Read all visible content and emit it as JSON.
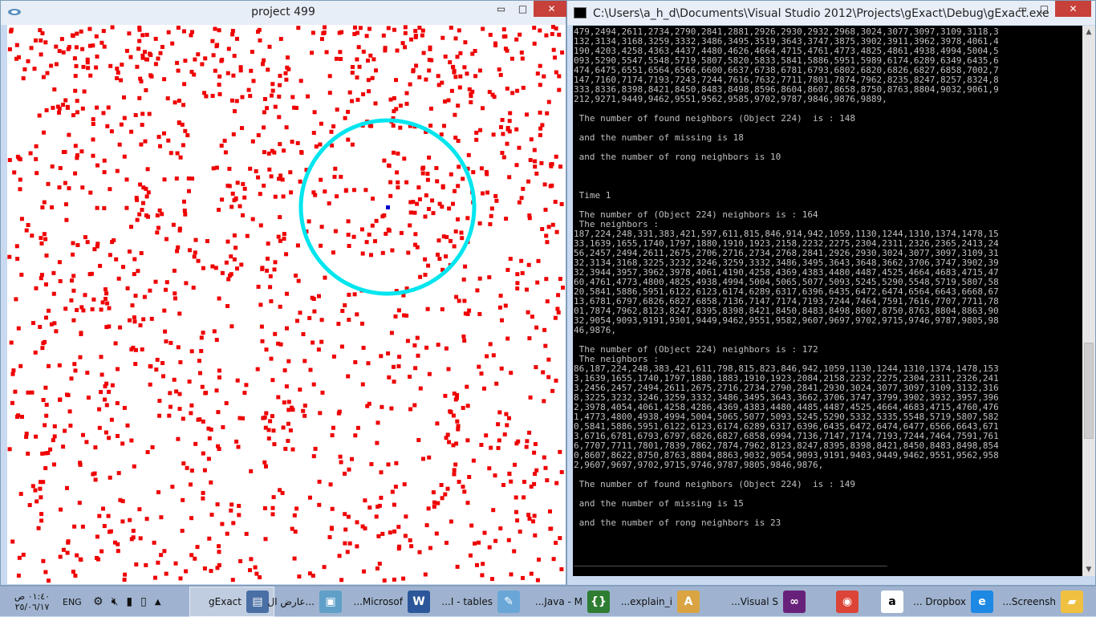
{
  "left_window": {
    "title": "project 499",
    "minimize": "▭",
    "maximize": "□",
    "close": "✕"
  },
  "right_window": {
    "title": "C:\\Users\\a_h_d\\Documents\\Visual Studio 2012\\Projects\\gExact\\Debug\\gExact.exe",
    "minimize": "▭",
    "maximize": "□",
    "close": "✕"
  },
  "console": {
    "lines": [
      "479,2494,2611,2734,2790,2841,2881,2926,2930,2932,2968,3024,3077,3097,3109,3118,3",
      "132,3134,3168,3259,3332,3486,3495,3519,3643,3747,3875,3902,3911,3962,3978,4061,4",
      "190,4203,4258,4363,4437,4480,4626,4664,4715,4761,4773,4825,4861,4938,4994,5004,5",
      "093,5290,5547,5548,5719,5807,5820,5833,5841,5886,5951,5989,6174,6289,6349,6435,6",
      "474,6475,6551,6564,6566,6600,6637,6738,6781,6793,6802,6820,6826,6827,6858,7002,7",
      "147,7160,7174,7193,7243,7244,7616,7632,7711,7801,7874,7962,8235,8247,8257,8324,8",
      "333,8336,8398,8421,8450,8483,8498,8596,8604,8607,8658,8750,8763,8804,9032,9061,9",
      "212,9271,9449,9462,9551,9562,9585,9702,9787,9846,9876,9889,",
      "",
      " The number of found neighbors (Object 224)  is : 148",
      "",
      " and the number of missing is 18",
      "",
      " and the number of rong neighbors is 10",
      "",
      "",
      "",
      " Time 1",
      "",
      " The number of (Object 224) neighbors is : 164",
      " The neighbors :",
      "187,224,248,331,383,421,597,611,815,846,914,942,1059,1130,1244,1310,1374,1478,15",
      "33,1639,1655,1740,1797,1880,1910,1923,2158,2232,2275,2304,2311,2326,2365,2413,24",
      "56,2457,2494,2611,2675,2706,2716,2734,2768,2841,2926,2930,3024,3077,3097,3109,31",
      "32,3134,3168,3225,3232,3246,3259,3332,3486,3495,3643,3648,3662,3706,3747,3902,39",
      "32,3944,3957,3962,3978,4061,4190,4258,4369,4383,4480,4487,4525,4664,4683,4715,47",
      "60,4761,4773,4800,4825,4938,4994,5004,5065,5077,5093,5245,5290,5548,5719,5807,58",
      "20,5841,5886,5951,6122,6123,6174,6289,6317,6396,6435,6472,6474,6564,6643,6668,67",
      "13,6781,6797,6826,6827,6858,7136,7147,7174,7193,7244,7464,7591,7616,7707,7711,78",
      "01,7874,7962,8123,8247,8395,8398,8421,8450,8483,8498,8607,8750,8763,8804,8863,90",
      "32,9054,9093,9191,9301,9449,9462,9551,9582,9607,9697,9702,9715,9746,9787,9805,98",
      "46,9876,",
      "",
      " The number of (Object 224) neighbors is : 172",
      " The neighbors :",
      "86,187,224,248,383,421,611,798,815,823,846,942,1059,1130,1244,1310,1374,1478,153",
      "3,1639,1655,1740,1797,1880,1883,1910,1923,2084,2158,2232,2275,2304,2311,2326,241",
      "3,2456,2457,2494,2611,2675,2716,2734,2790,2841,2930,3024,3077,3097,3109,3132,316",
      "8,3225,3232,3246,3259,3332,3486,3495,3643,3662,3706,3747,3799,3902,3932,3957,396",
      "2,3978,4054,4061,4258,4286,4369,4383,4480,4485,4487,4525,4664,4683,4715,4760,476",
      "1,4773,4800,4938,4994,5004,5065,5077,5093,5245,5290,5332,5335,5548,5719,5807,582",
      "0,5841,5886,5951,6122,6123,6174,6289,6317,6396,6435,6472,6474,6477,6566,6643,671",
      "3,6716,6781,6793,6797,6826,6827,6858,6994,7136,7147,7174,7193,7244,7464,7591,761",
      "6,7707,7711,7801,7839,7862,7874,7962,8123,8247,8395,8398,8421,8450,8483,8498,854",
      "0,8607,8622,8750,8763,8804,8863,9032,9054,9093,9191,9403,9449,9462,9551,9562,958",
      "2,9607,9697,9702,9715,9746,9787,9805,9846,9876,",
      "",
      " The number of found neighbors (Object 224)  is : 149",
      "",
      " and the number of missing is 15",
      "",
      " and the number of rong neighbors is 23",
      "",
      "",
      "",
      "___________________________________________________________"
    ]
  },
  "scene": {
    "point_color": "#ee0000",
    "circle_color": "#00e5ee",
    "target_color": "#0000cc"
  },
  "taskbar": {
    "items": [
      {
        "label": "gExact",
        "icon": "console-app-icon",
        "color": "#4a6fa5",
        "glyph": "▤"
      },
      {
        "label": "عارض ال...",
        "icon": "photo-viewer-icon",
        "color": "#5f9fc8",
        "glyph": "▣"
      },
      {
        "label": "...Microsof",
        "icon": "word-icon",
        "color": "#2b579a",
        "glyph": "W"
      },
      {
        "label": "...I - tables",
        "icon": "notepad-icon",
        "color": "#6aa7d8",
        "glyph": "✎"
      },
      {
        "label": "...Java - M",
        "icon": "java-ide-icon",
        "color": "#2e7d32",
        "glyph": "{}"
      },
      {
        "label": "...explain_i",
        "icon": "document-icon",
        "color": "#d9a441",
        "glyph": "A"
      },
      {
        "label": "...Visual S",
        "icon": "visual-studio-icon",
        "color": "#68217a",
        "glyph": "∞"
      },
      {
        "label": "",
        "icon": "chrome-icon",
        "color": "#db4437",
        "glyph": "◉"
      },
      {
        "label": "",
        "icon": "amazon-icon",
        "color": "#ffffff",
        "glyph": "a"
      },
      {
        "label": "... Dropbox",
        "icon": "ie-icon",
        "color": "#1e88e5",
        "glyph": "e"
      },
      {
        "label": "...Screensh",
        "icon": "folder-icon",
        "color": "#f0c040",
        "glyph": "▰"
      }
    ],
    "clock_time": "٠١:٤٠ ص",
    "clock_date": "٢٥/٠٦/١٧",
    "lang": "ENG"
  }
}
